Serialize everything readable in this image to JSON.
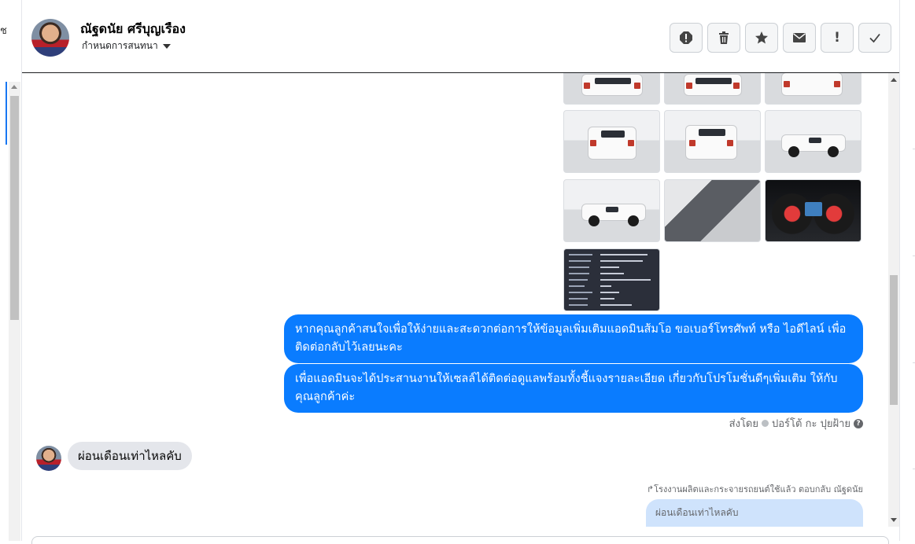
{
  "left_rail": {
    "glyph": "ช"
  },
  "header": {
    "contact_name": "ณัฐดนัย ศรีบุญเรือง",
    "assign_label": "กำหนดการสนทนา",
    "actions": [
      {
        "icon": "spam-icon"
      },
      {
        "icon": "trash-icon"
      },
      {
        "icon": "star-icon"
      },
      {
        "icon": "envelope-icon"
      },
      {
        "icon": "exclamation-icon",
        "label": "!"
      },
      {
        "icon": "checkmark-icon"
      }
    ]
  },
  "messages": {
    "photo_count": 10,
    "outgoing": [
      "หากคุณลูกค้าสนใจเพื่อให้ง่ายและสะดวกต่อการให้ข้อมูลเพิ่มเติมแอดมินส้มโอ ขอเบอร์โทรศัพท์ หรือ ไอดีไลน์ เพื่อติดต่อกลับไว้เลยนะคะ",
      "เพื่อแอดมินจะได้ประสานงานให้เซลล์ได้ติดต่อดูแลพร้อมทั้งชี้แจงรายละเอียด เกี่ยวกับโปรโมชั่นดีๆเพิ่มเติม ให้กับคุณลูกค้าค่ะ"
    ],
    "sent_by_label": "ส่งโดย",
    "sent_by_name": "ปอร์โต้ กะ ปุยฝ้าย",
    "incoming": "ผ่อนเดือนเท่าไหลคับ",
    "reply_note": "↱โรงงานผลิตและกระจายรถยนต์ใช้แล้ว ตอบกลับ ณัฐดนัย",
    "reply_quote": "ผ่อนเดือนเท่าไหลคับ"
  },
  "colors": {
    "accent": "#0a7cff",
    "incoming_bubble": "#e4e6eb",
    "quote_bg": "#cfe3fc"
  }
}
